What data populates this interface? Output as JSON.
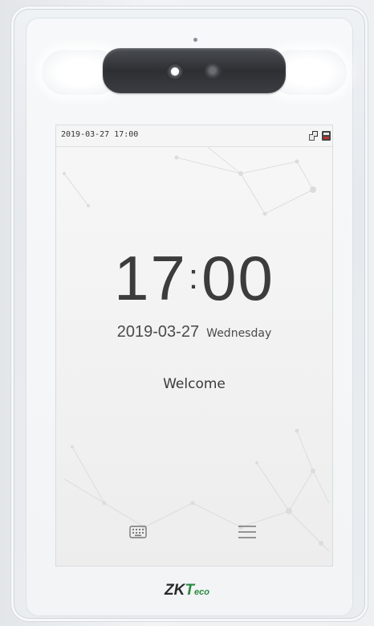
{
  "status_bar": {
    "datetime": "2019-03-27  17:00",
    "icons": [
      "network-icon",
      "card-reader-icon"
    ]
  },
  "clock": {
    "hours": "17",
    "separator": ":",
    "minutes": "00"
  },
  "date": {
    "value": "2019-03-27",
    "weekday": "Wednesday"
  },
  "welcome": {
    "message": "Welcome"
  },
  "softkeys": {
    "left_icon": "keyboard-icon",
    "right_icon": "menu-icon"
  },
  "brand": {
    "part1": "ZK",
    "part2": "T",
    "part3": "eco"
  },
  "colors": {
    "brand_green": "#2b8a3e",
    "camera_housing": "#2d2f33",
    "screen_bg": "#f2f2f2"
  }
}
